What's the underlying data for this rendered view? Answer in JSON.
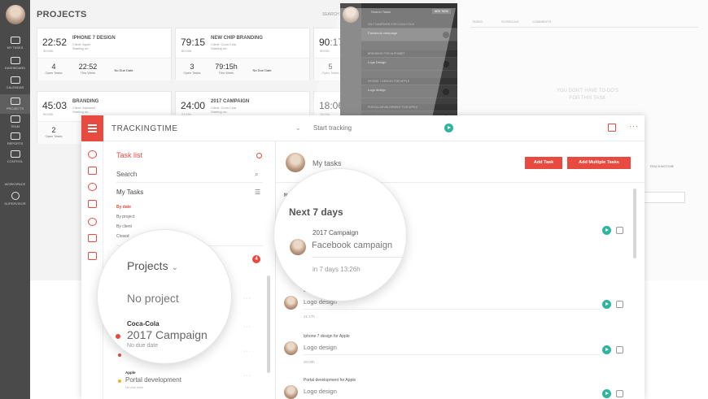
{
  "bg_app": {
    "title": "PROJECTS",
    "search_label": "SEARCH",
    "nav": [
      "MY TASKS",
      "DASHBOARD",
      "CALENDAR",
      "PROJECTS",
      "TEAM",
      "REPORTS",
      "CONTROL",
      "WORKSPACE",
      "SUPERVISOR"
    ],
    "cards": [
      {
        "time": "22:52",
        "time_sub": "30:00h",
        "name": "IPHONE 7 DESIGN",
        "client": "Client: Apple",
        "client2": "Starting on:",
        "stat1": "4",
        "stat1_label": "Open Tasks",
        "stat2": "22:52",
        "stat2_label": "This Week",
        "stat3": "No Due Date"
      },
      {
        "time": "79:15",
        "time_sub": "80:00h",
        "name": "NEW CHIP BRANDING",
        "client": "Client: Coca Cola",
        "client2": "Starting on:",
        "stat1": "3",
        "stat1_label": "Open Tasks",
        "stat2": "79:15h",
        "stat2_label": "This Week",
        "stat3": "No Due Date"
      },
      {
        "time": "90:17",
        "time_sub": "90:00h",
        "name": "",
        "client": "",
        "client2": "",
        "stat1": "5",
        "stat1_label": "Open Tasks",
        "stat2": "",
        "stat2_label": "",
        "stat3": ""
      },
      {
        "time": "45:03",
        "time_sub": "50:00h",
        "name": "BRANDING",
        "client": "Client: Alphabet",
        "client2": "Starting on:",
        "stat1": "2",
        "stat1_label": "Open Tasks",
        "stat2": "",
        "stat2_label": "",
        "stat3": ""
      },
      {
        "time": "24:00",
        "time_sub": "24:00h",
        "name": "2017 CAMPAIGN",
        "client": "Client: Coca Cola",
        "client2": "Starting on:",
        "stat1": "",
        "stat1_label": "",
        "stat2": "",
        "stat2_label": "",
        "stat3": ""
      },
      {
        "time": "18:06",
        "time_sub": "18:00h",
        "name": "",
        "client": "",
        "client2": "",
        "stat1": "",
        "stat1_label": "",
        "stat2": "",
        "stat2_label": "",
        "stat3": ""
      }
    ]
  },
  "dark_panel": {
    "search": "Search Tasks",
    "button": "ADD TASK",
    "rows": [
      {
        "section": true,
        "text": "2017 CAMPAIGN FOR COCA COLA"
      },
      {
        "section": false,
        "text": "Facebook campaign"
      },
      {
        "section": true,
        "text": "BRANDING FOR ALPHABET"
      },
      {
        "section": false,
        "text": "Logo Design"
      },
      {
        "section": true,
        "text": "IPHONE 7 DESIGN FOR APPLE"
      },
      {
        "section": false,
        "text": "Logo design"
      },
      {
        "section": true,
        "text": "PORTAL DEVELOPMENT FOR APPLE"
      },
      {
        "section": false,
        "text": "Logo design"
      }
    ]
  },
  "right_bg": {
    "tabs": [
      "TASKS",
      "SCHEDULE",
      "COMMENTS"
    ],
    "empty_line1": "YOU DON'T HAVE TO-DO'S",
    "empty_line2": "FOR THIS TASK",
    "brand": "TRACKINGTIME"
  },
  "main": {
    "brand": "TRACKINGTIME",
    "start_tracking_placeholder": "Start tracking",
    "caret": "⌄",
    "more": "···",
    "left": {
      "task_list": "Task list",
      "search_value": "Search",
      "my_tasks": "My Tasks",
      "views": [
        "By date",
        "By project",
        "By client",
        "Closed"
      ],
      "projects_count": "4",
      "item_dots": "···",
      "list": [
        {
          "client": "",
          "project": "",
          "dot": ""
        },
        {
          "client": "Apple",
          "project": "Portal development",
          "dot": "#f2b21c",
          "nodue": "No due date"
        }
      ]
    },
    "right": {
      "title": "My tasks",
      "add_task": "Add Task",
      "add_multiple": "Add Multiple Tasks",
      "sections": [
        "Next",
        "N"
      ],
      "tasks": [
        {
          "project": "Brand",
          "name": "Logo design",
          "time": "21:17h"
        },
        {
          "project": "Iphone 7 design for Apple",
          "name": "Logo design",
          "time": "00:00h"
        },
        {
          "project": "Portal development for Apple",
          "name": "Logo design",
          "time": ""
        }
      ]
    }
  },
  "magnifier_tasks": {
    "heading": "Next 7 days",
    "project": "2017 Campaign",
    "task": "Facebook campaign",
    "meta": "in 7 days   13:26h"
  },
  "magnifier_projects": {
    "heading": "Projects",
    "chevron": "⌄",
    "no_project": "No project",
    "client": "Coca-Cola",
    "project": "2017 Campaign",
    "nodue": "No due date"
  },
  "colors": {
    "accent": "#e94a3f",
    "play": "#2fb4a0"
  }
}
